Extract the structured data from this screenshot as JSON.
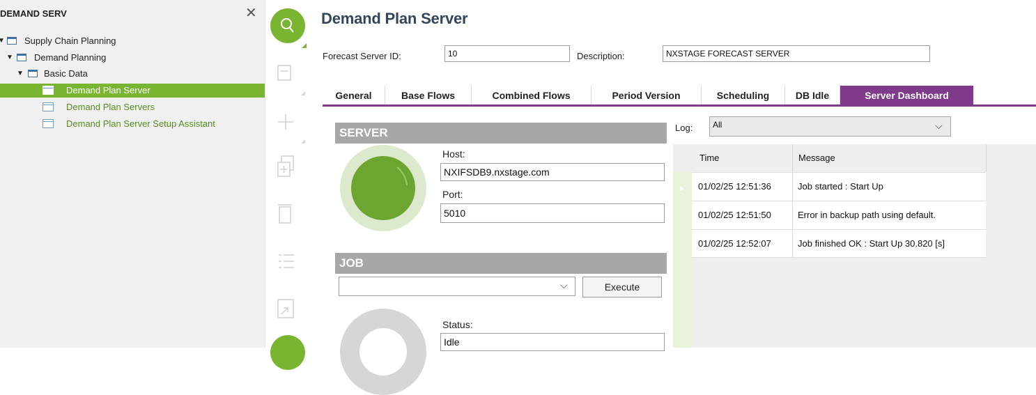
{
  "navigator": {
    "title": "DEMAND SERV",
    "close_icon": "close-icon",
    "tree": [
      {
        "label": "Supply Chain Planning",
        "icon": "folder-icon",
        "expanded": true
      },
      {
        "label": "Demand Planning",
        "icon": "folder-icon",
        "expanded": true
      },
      {
        "label": "Basic Data",
        "icon": "folder-icon",
        "expanded": true
      },
      {
        "label": "Demand Plan Server",
        "icon": "form-page-icon",
        "selected": true
      },
      {
        "label": "Demand Plan Servers",
        "icon": "list-page-icon"
      },
      {
        "label": "Demand Plan Server Setup Assistant",
        "icon": "assistant-page-icon"
      }
    ]
  },
  "toolbar": {
    "buttons": [
      "search-icon",
      "save-icon",
      "add-icon",
      "duplicate-icon",
      "delete-icon",
      "list-icon",
      "export-icon"
    ]
  },
  "page": {
    "title": "Demand Plan Server",
    "forecast_server_id_label": "Forecast Server ID:",
    "forecast_server_id": "10",
    "description_label": "Description:",
    "description": "NXSTAGE FORECAST SERVER"
  },
  "tabs": [
    {
      "label": "General"
    },
    {
      "label": "Base Flows"
    },
    {
      "label": "Combined Flows"
    },
    {
      "label": "Period Version"
    },
    {
      "label": "Scheduling"
    },
    {
      "label": "DB Idle"
    },
    {
      "label": "Server Dashboard",
      "active": true
    }
  ],
  "server": {
    "header": "SERVER",
    "host_label": "Host:",
    "host": "NXIFSDB9.nxstage.com",
    "port_label": "Port:",
    "port": "5010",
    "indicator_color": "#6ea531"
  },
  "job": {
    "header": "JOB",
    "selected": "",
    "execute_label": "Execute",
    "status_label": "Status:",
    "status": "Idle"
  },
  "log": {
    "label": "Log:",
    "filter": "All",
    "columns": [
      "Time",
      "Message"
    ],
    "rows": [
      {
        "time": "01/02/25 12:51:36",
        "message": "Job started : Start Up"
      },
      {
        "time": "01/02/25 12:51:50",
        "message": "Error in backup path using default."
      },
      {
        "time": "01/02/25 12:52:07",
        "message": "Job finished OK : Start Up 30.820 [s]"
      }
    ]
  },
  "colors": {
    "accent_green": "#7ab531",
    "tab_purple": "#7f3a8c",
    "title_navy": "#33455b"
  }
}
